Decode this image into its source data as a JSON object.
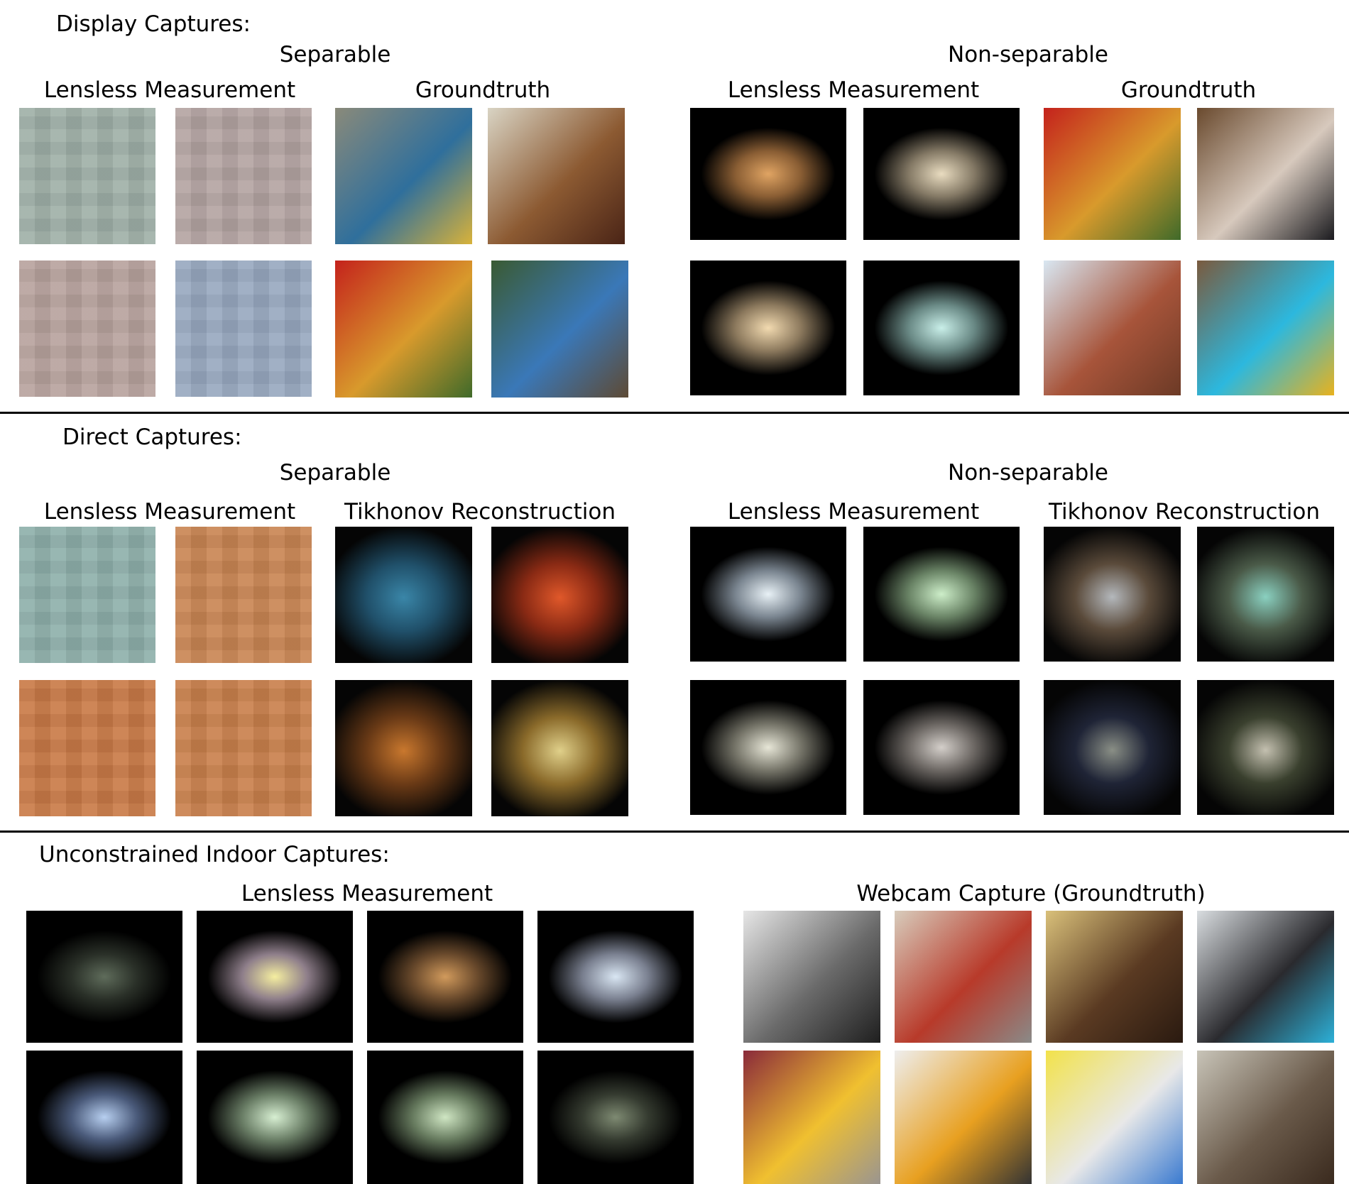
{
  "sections": {
    "display": {
      "heading": "Display Captures:",
      "separable": {
        "title": "Separable",
        "measurement_label": "Lensless Measurement",
        "right_label": "Groundtruth"
      },
      "non_separable": {
        "title": "Non-separable",
        "measurement_label": "Lensless Measurement",
        "right_label": "Groundtruth"
      }
    },
    "direct": {
      "heading": "Direct Captures:",
      "separable": {
        "title": "Separable",
        "measurement_label": "Lensless Measurement",
        "right_label": "Tikhonov Reconstruction"
      },
      "non_separable": {
        "title": "Non-separable",
        "measurement_label": "Lensless Measurement",
        "right_label": "Tikhonov Reconstruction"
      }
    },
    "indoor": {
      "heading": "Unconstrained Indoor Captures:",
      "measurement_label": "Lensless Measurement",
      "webcam_label": "Webcam Capture (Groundtruth)"
    }
  },
  "images": {
    "display_sep_meas": [
      "#9fb0a8",
      "#b4a4a2",
      "#b8a39e",
      "#98a9c0"
    ],
    "display_sep_gt": [
      "parrot",
      "room",
      "ladybug",
      "moped"
    ],
    "display_nonsep_meas": [
      "#e0a463",
      "#e9dcc0",
      "#f2dab0",
      "#c9efe9"
    ],
    "display_nonsep_gt": [
      "ladybug",
      "man-bookshelf",
      "castle",
      "scooter"
    ],
    "direct_sep_meas": [
      "#8fb0ab",
      "#c98553",
      "#c97a47",
      "#c9804c"
    ],
    "direct_sep_recon": [
      "lightbulb-box",
      "lab-snacks-box",
      "teddy-dog",
      "topi-toy"
    ],
    "direct_nonsep_meas": [
      "#e8f1f6",
      "#cdeec9",
      "#e7e6d7",
      "#d4cfca"
    ],
    "direct_nonsep_recon": [
      "flatcam-tpami-toys",
      "plush-toys",
      "mug-toys",
      "house-dog-toy"
    ],
    "indoor_meas": [
      "#5f6c5b",
      "#f5eea0",
      "#d19a5c",
      "#d9e6f3",
      "#b7cff0",
      "#d7efd2",
      "#cfe6c3",
      "#7e8a72"
    ],
    "indoor_webcam": [
      "foosball",
      "fire-extinguisher",
      "bench-bird",
      "amplifier",
      "yellow-chair",
      "lounge-chair",
      "model-airplane",
      "oscilloscope"
    ]
  }
}
